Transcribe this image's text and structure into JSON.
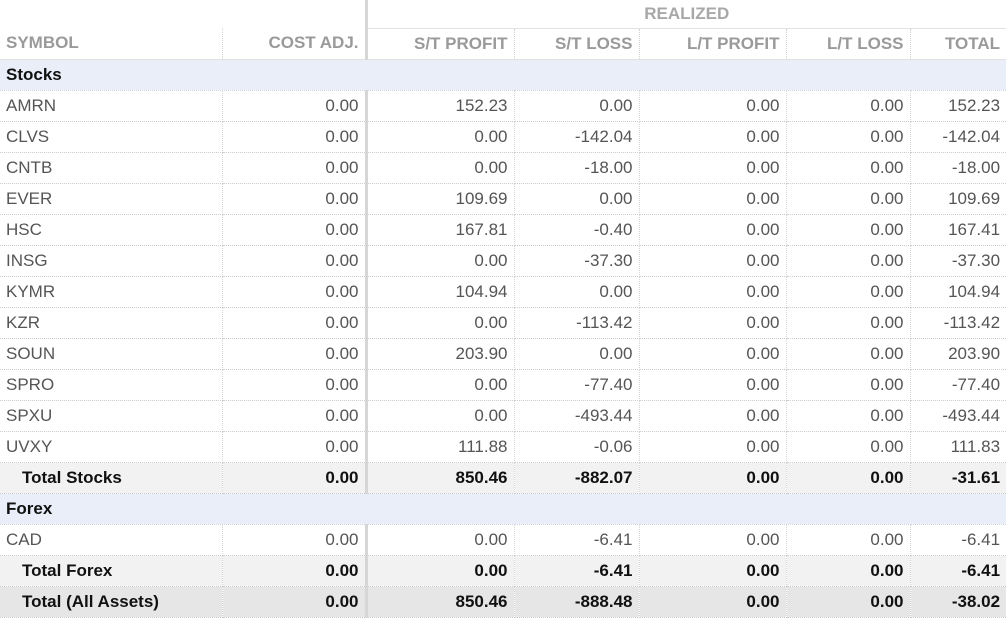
{
  "header": {
    "group_label": "REALIZED",
    "columns": [
      "SYMBOL",
      "COST ADJ.",
      "S/T PROFIT",
      "S/T LOSS",
      "L/T PROFIT",
      "L/T LOSS",
      "TOTAL"
    ]
  },
  "sections": [
    {
      "title": "Stocks",
      "rows": [
        [
          "AMRN",
          "0.00",
          "152.23",
          "0.00",
          "0.00",
          "0.00",
          "152.23"
        ],
        [
          "CLVS",
          "0.00",
          "0.00",
          "-142.04",
          "0.00",
          "0.00",
          "-142.04"
        ],
        [
          "CNTB",
          "0.00",
          "0.00",
          "-18.00",
          "0.00",
          "0.00",
          "-18.00"
        ],
        [
          "EVER",
          "0.00",
          "109.69",
          "0.00",
          "0.00",
          "0.00",
          "109.69"
        ],
        [
          "HSC",
          "0.00",
          "167.81",
          "-0.40",
          "0.00",
          "0.00",
          "167.41"
        ],
        [
          "INSG",
          "0.00",
          "0.00",
          "-37.30",
          "0.00",
          "0.00",
          "-37.30"
        ],
        [
          "KYMR",
          "0.00",
          "104.94",
          "0.00",
          "0.00",
          "0.00",
          "104.94"
        ],
        [
          "KZR",
          "0.00",
          "0.00",
          "-113.42",
          "0.00",
          "0.00",
          "-113.42"
        ],
        [
          "SOUN",
          "0.00",
          "203.90",
          "0.00",
          "0.00",
          "0.00",
          "203.90"
        ],
        [
          "SPRO",
          "0.00",
          "0.00",
          "-77.40",
          "0.00",
          "0.00",
          "-77.40"
        ],
        [
          "SPXU",
          "0.00",
          "0.00",
          "-493.44",
          "0.00",
          "0.00",
          "-493.44"
        ],
        [
          "UVXY",
          "0.00",
          "111.88",
          "-0.06",
          "0.00",
          "0.00",
          "111.83"
        ]
      ],
      "total": [
        "Total Stocks",
        "0.00",
        "850.46",
        "-882.07",
        "0.00",
        "0.00",
        "-31.61"
      ]
    },
    {
      "title": "Forex",
      "rows": [
        [
          "CAD",
          "0.00",
          "0.00",
          "-6.41",
          "0.00",
          "0.00",
          "-6.41"
        ]
      ],
      "total": [
        "Total Forex",
        "0.00",
        "0.00",
        "-6.41",
        "0.00",
        "0.00",
        "-6.41"
      ]
    }
  ],
  "grand_total": [
    "Total (All Assets)",
    "0.00",
    "850.46",
    "-888.48",
    "0.00",
    "0.00",
    "-38.02"
  ]
}
